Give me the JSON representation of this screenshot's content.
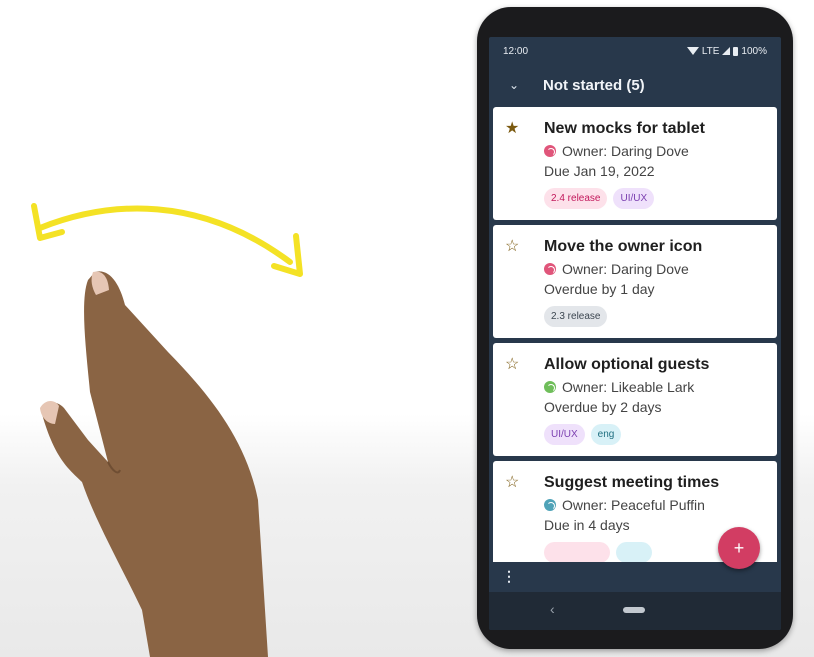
{
  "status_bar": {
    "time": "12:00",
    "network": "LTE",
    "battery": "100%"
  },
  "section": {
    "title": "Not started (5)",
    "chevron_icon": "chevron-down-icon"
  },
  "tasks": [
    {
      "title": "New mocks for tablet",
      "starred": true,
      "owner": "Owner: Daring Dove",
      "owner_color": "#e0557a",
      "due": "Due Jan 19, 2022",
      "chips": [
        {
          "label": "2.4 release",
          "bg": "#fde1ea",
          "fg": "#c2185b"
        },
        {
          "label": "UI/UX",
          "bg": "#efe1fb",
          "fg": "#7b3fb0"
        }
      ]
    },
    {
      "title": "Move the owner icon",
      "starred": false,
      "owner": "Owner: Daring Dove",
      "owner_color": "#e0557a",
      "due": "Overdue by 1 day",
      "chips": [
        {
          "label": "2.3 release",
          "bg": "#e3e6ea",
          "fg": "#3c4650"
        }
      ]
    },
    {
      "title": "Allow optional guests",
      "starred": false,
      "owner": "Owner: Likeable Lark",
      "owner_color": "#6fbe5a",
      "due": "Overdue by 2 days",
      "chips": [
        {
          "label": "UI/UX",
          "bg": "#efe1fb",
          "fg": "#7b3fb0"
        },
        {
          "label": "eng",
          "bg": "#d8f1f7",
          "fg": "#1f6f80"
        }
      ]
    },
    {
      "title": "Suggest meeting times",
      "starred": false,
      "owner": "Owner: Peaceful Puffin",
      "owner_color": "#4fa3b8",
      "due": "Due in 4 days",
      "chips": [
        {
          "label": "",
          "bg": "#fde1ea",
          "fg": "#c2185b"
        },
        {
          "label": "",
          "bg": "#d8f1f7",
          "fg": "#1f6f80"
        }
      ]
    }
  ],
  "bottom_bar": {
    "menu_label": "⋮"
  },
  "fab": {
    "label": "+"
  },
  "nav": {
    "back_label": "‹"
  },
  "colors": {
    "toolbar": "#28384b",
    "card": "#ffffff",
    "fab": "#d23d63",
    "gesture_arrow": "#f4e225",
    "hand": "#8a6444"
  }
}
